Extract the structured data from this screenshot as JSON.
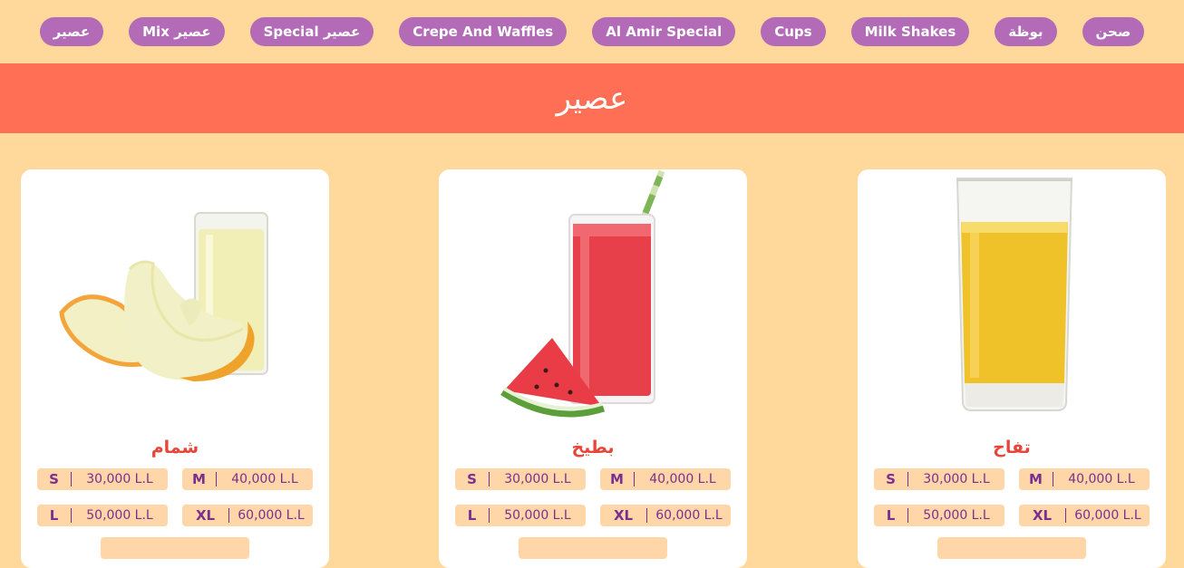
{
  "nav": {
    "items": [
      {
        "label": "صحن"
      },
      {
        "label": "بوظة"
      },
      {
        "label": "Milk Shakes"
      },
      {
        "label": "Cups"
      },
      {
        "label": "Al Amir Special"
      },
      {
        "label": "Crepe And Waffles"
      },
      {
        "label": "Special عصير"
      },
      {
        "label": "Mix عصير"
      },
      {
        "label": "عصير"
      }
    ]
  },
  "section": {
    "title": "عصير"
  },
  "products": [
    {
      "name": "شمام",
      "image_icon": "melon-juice-image",
      "prices": [
        {
          "size": "S",
          "price": "30,000 L.L"
        },
        {
          "size": "M",
          "price": "40,000 L.L"
        },
        {
          "size": "L",
          "price": "50,000 L.L"
        },
        {
          "size": "XL",
          "price": "60,000 L.L"
        }
      ]
    },
    {
      "name": "بطيخ",
      "image_icon": "watermelon-juice-image",
      "prices": [
        {
          "size": "S",
          "price": "30,000 L.L"
        },
        {
          "size": "M",
          "price": "40,000 L.L"
        },
        {
          "size": "L",
          "price": "50,000 L.L"
        },
        {
          "size": "XL",
          "price": "60,000 L.L"
        }
      ]
    },
    {
      "name": "تفاح",
      "image_icon": "apple-juice-image",
      "prices": [
        {
          "size": "S",
          "price": "30,000 L.L"
        },
        {
          "size": "M",
          "price": "40,000 L.L"
        },
        {
          "size": "L",
          "price": "50,000 L.L"
        },
        {
          "size": "XL",
          "price": "60,000 L.L"
        }
      ]
    }
  ],
  "colors": {
    "background": "#ffd99b",
    "pill": "#b36bb8",
    "banner": "#ff6f55",
    "product_name": "#e6463a",
    "price_bg": "#ffd6a7",
    "price_text": "#7a2f90"
  }
}
